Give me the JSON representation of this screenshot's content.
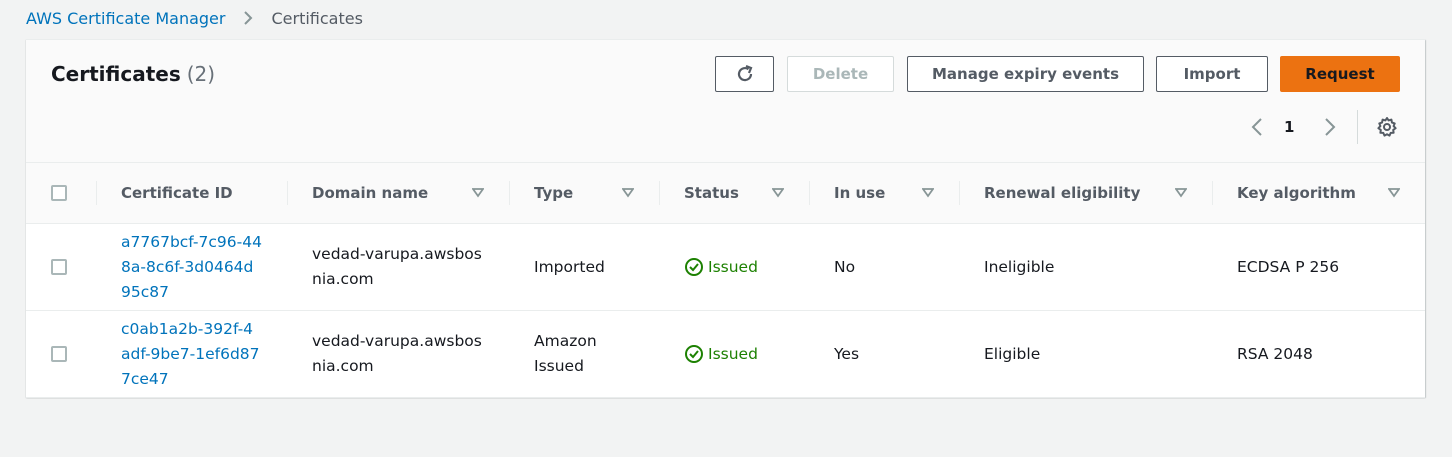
{
  "breadcrumb": {
    "root": "AWS Certificate Manager",
    "current": "Certificates"
  },
  "panel": {
    "title": "Certificates",
    "count": "(2)"
  },
  "actions": {
    "refresh_icon": "refresh-icon",
    "delete": "Delete",
    "manage_expiry": "Manage expiry events",
    "import": "Import",
    "request": "Request"
  },
  "pagination": {
    "current_page": "1"
  },
  "table": {
    "columns": [
      {
        "label": "Certificate ID",
        "sortable": false
      },
      {
        "label": "Domain name",
        "sortable": true
      },
      {
        "label": "Type",
        "sortable": true
      },
      {
        "label": "Status",
        "sortable": true
      },
      {
        "label": "In use",
        "sortable": true
      },
      {
        "label": "Renewal eligibility",
        "sortable": true
      },
      {
        "label": "Key algorithm",
        "sortable": true
      }
    ],
    "rows": [
      {
        "certificate_id": "a7767bcf-7c96-448a-8c6f-3d0464d95c87",
        "domain_name": "vedad-varupa.awsbosnia.com",
        "type": "Imported",
        "status": "Issued",
        "in_use": "No",
        "renewal_eligibility": "Ineligible",
        "key_algorithm": "ECDSA P 256"
      },
      {
        "certificate_id": "c0ab1a2b-392f-4adf-9be7-1ef6d877ce47",
        "domain_name": "vedad-varupa.awsbosnia.com",
        "type": "Amazon Issued",
        "status": "Issued",
        "in_use": "Yes",
        "renewal_eligibility": "Eligible",
        "key_algorithm": "RSA 2048"
      }
    ]
  },
  "colors": {
    "link": "#0073bb",
    "primary": "#ec7211",
    "success": "#1d8102"
  }
}
